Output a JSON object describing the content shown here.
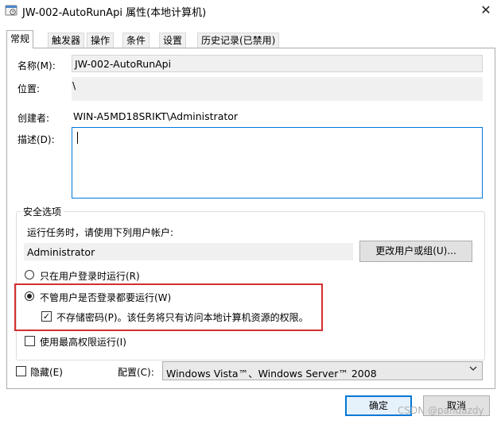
{
  "window": {
    "title": "JW-002-AutoRunApi 属性(本地计算机)",
    "close_glyph": "✕"
  },
  "tabs": [
    {
      "label": "常规",
      "active": true
    },
    {
      "label": "触发器"
    },
    {
      "label": "操作"
    },
    {
      "label": "条件"
    },
    {
      "label": "设置"
    },
    {
      "label": "历史记录(已禁用)"
    }
  ],
  "general": {
    "name_label": "名称(M):",
    "name_value": "JW-002-AutoRunApi",
    "location_label": "位置:",
    "location_value": "\\",
    "author_label": "创建者:",
    "author_value": "WIN-A5MD18SRIKT\\Administrator",
    "description_label": "描述(D):",
    "description_value": ""
  },
  "security": {
    "legend": "安全选项",
    "run_as_prompt": "运行任务时，请使用下列用户帐户:",
    "user_account": "Administrator",
    "change_user_button": "更改用户或组(U)...",
    "radio_logged_on": "只在用户登录时运行(R)",
    "radio_whether_logged_on": "不管用户是否登录都要运行(W)",
    "selected_radio": "radio_whether_logged_on",
    "no_store_password": "不存储密码(P)。该任务将只有访问本地计算机资源的权限。",
    "no_store_password_checked": true,
    "highest_privileges": "使用最高权限运行(I)",
    "highest_privileges_checked": false
  },
  "footer": {
    "hidden_label": "隐藏(E)",
    "hidden_checked": false,
    "configure_label": "配置(C):",
    "configure_value": "Windows Vista™、Windows Server™ 2008",
    "ok_button": "确定",
    "cancel_button": "取消"
  },
  "watermark": "CSDN @pandazdy",
  "colors": {
    "highlight_box": "#d32f2f",
    "focus_accent": "#0078d7"
  },
  "icons": {
    "app_icon": "task-scheduler-icon",
    "close": "close-icon",
    "dropdown": "chevron-down-icon",
    "check": "check-mark-icon"
  }
}
